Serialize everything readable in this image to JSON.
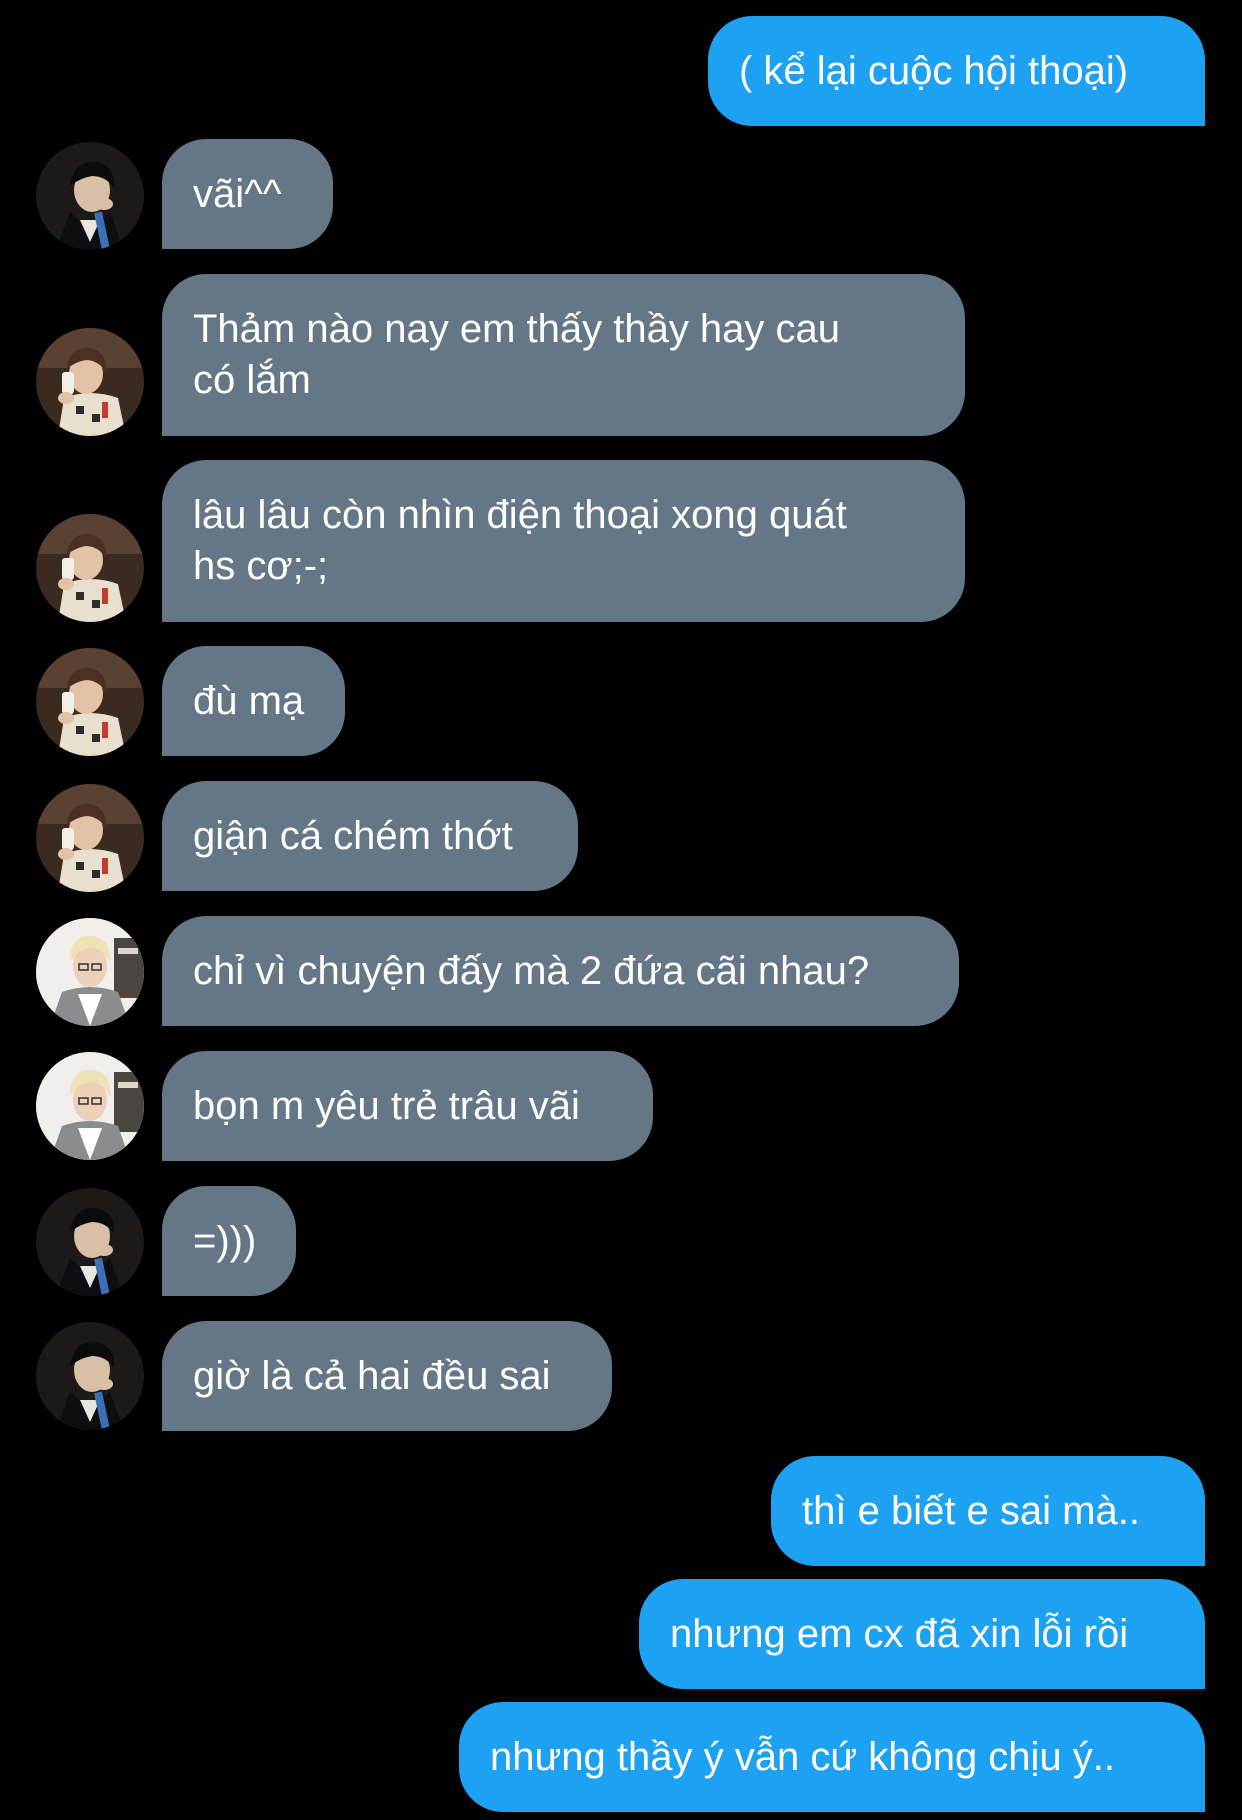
{
  "colors": {
    "background": "#000000",
    "outgoing_bubble": "#1da1f2",
    "incoming_bubble": "#657786",
    "text": "#ffffff"
  },
  "messages": [
    {
      "direction": "out",
      "text": "( kể lại cuộc hội thoại)"
    },
    {
      "direction": "in",
      "avatar": "dark-haired-boy-avatar",
      "text": "vãi^^"
    },
    {
      "direction": "in",
      "avatar": "boy-phone-avatar",
      "text": "Thảm nào nay em thấy thầy hay cau\ncó lắm"
    },
    {
      "direction": "in",
      "avatar": "boy-phone-avatar",
      "text": "lâu lâu còn nhìn điện thoại xong quát\nhs cơ;-;"
    },
    {
      "direction": "in",
      "avatar": "boy-phone-avatar",
      "text": "đù mạ"
    },
    {
      "direction": "in",
      "avatar": "boy-phone-avatar",
      "text": "giận cá chém thớt"
    },
    {
      "direction": "in",
      "avatar": "blond-boy-avatar",
      "text": "chỉ vì chuyện đấy mà 2 đứa cãi nhau?"
    },
    {
      "direction": "in",
      "avatar": "blond-boy-avatar",
      "text": "bọn m yêu trẻ trâu vãi"
    },
    {
      "direction": "in",
      "avatar": "dark-haired-boy-avatar",
      "text": "=)))"
    },
    {
      "direction": "in",
      "avatar": "dark-haired-boy-avatar",
      "text": "giờ là cả hai đều sai"
    },
    {
      "direction": "out",
      "text": "thì e biết e sai mà.."
    },
    {
      "direction": "out",
      "text": "nhưng em cx đã xin lỗi rồi"
    },
    {
      "direction": "out",
      "text": "nhưng thầy ý vẫn cứ không chịu ý.."
    }
  ]
}
